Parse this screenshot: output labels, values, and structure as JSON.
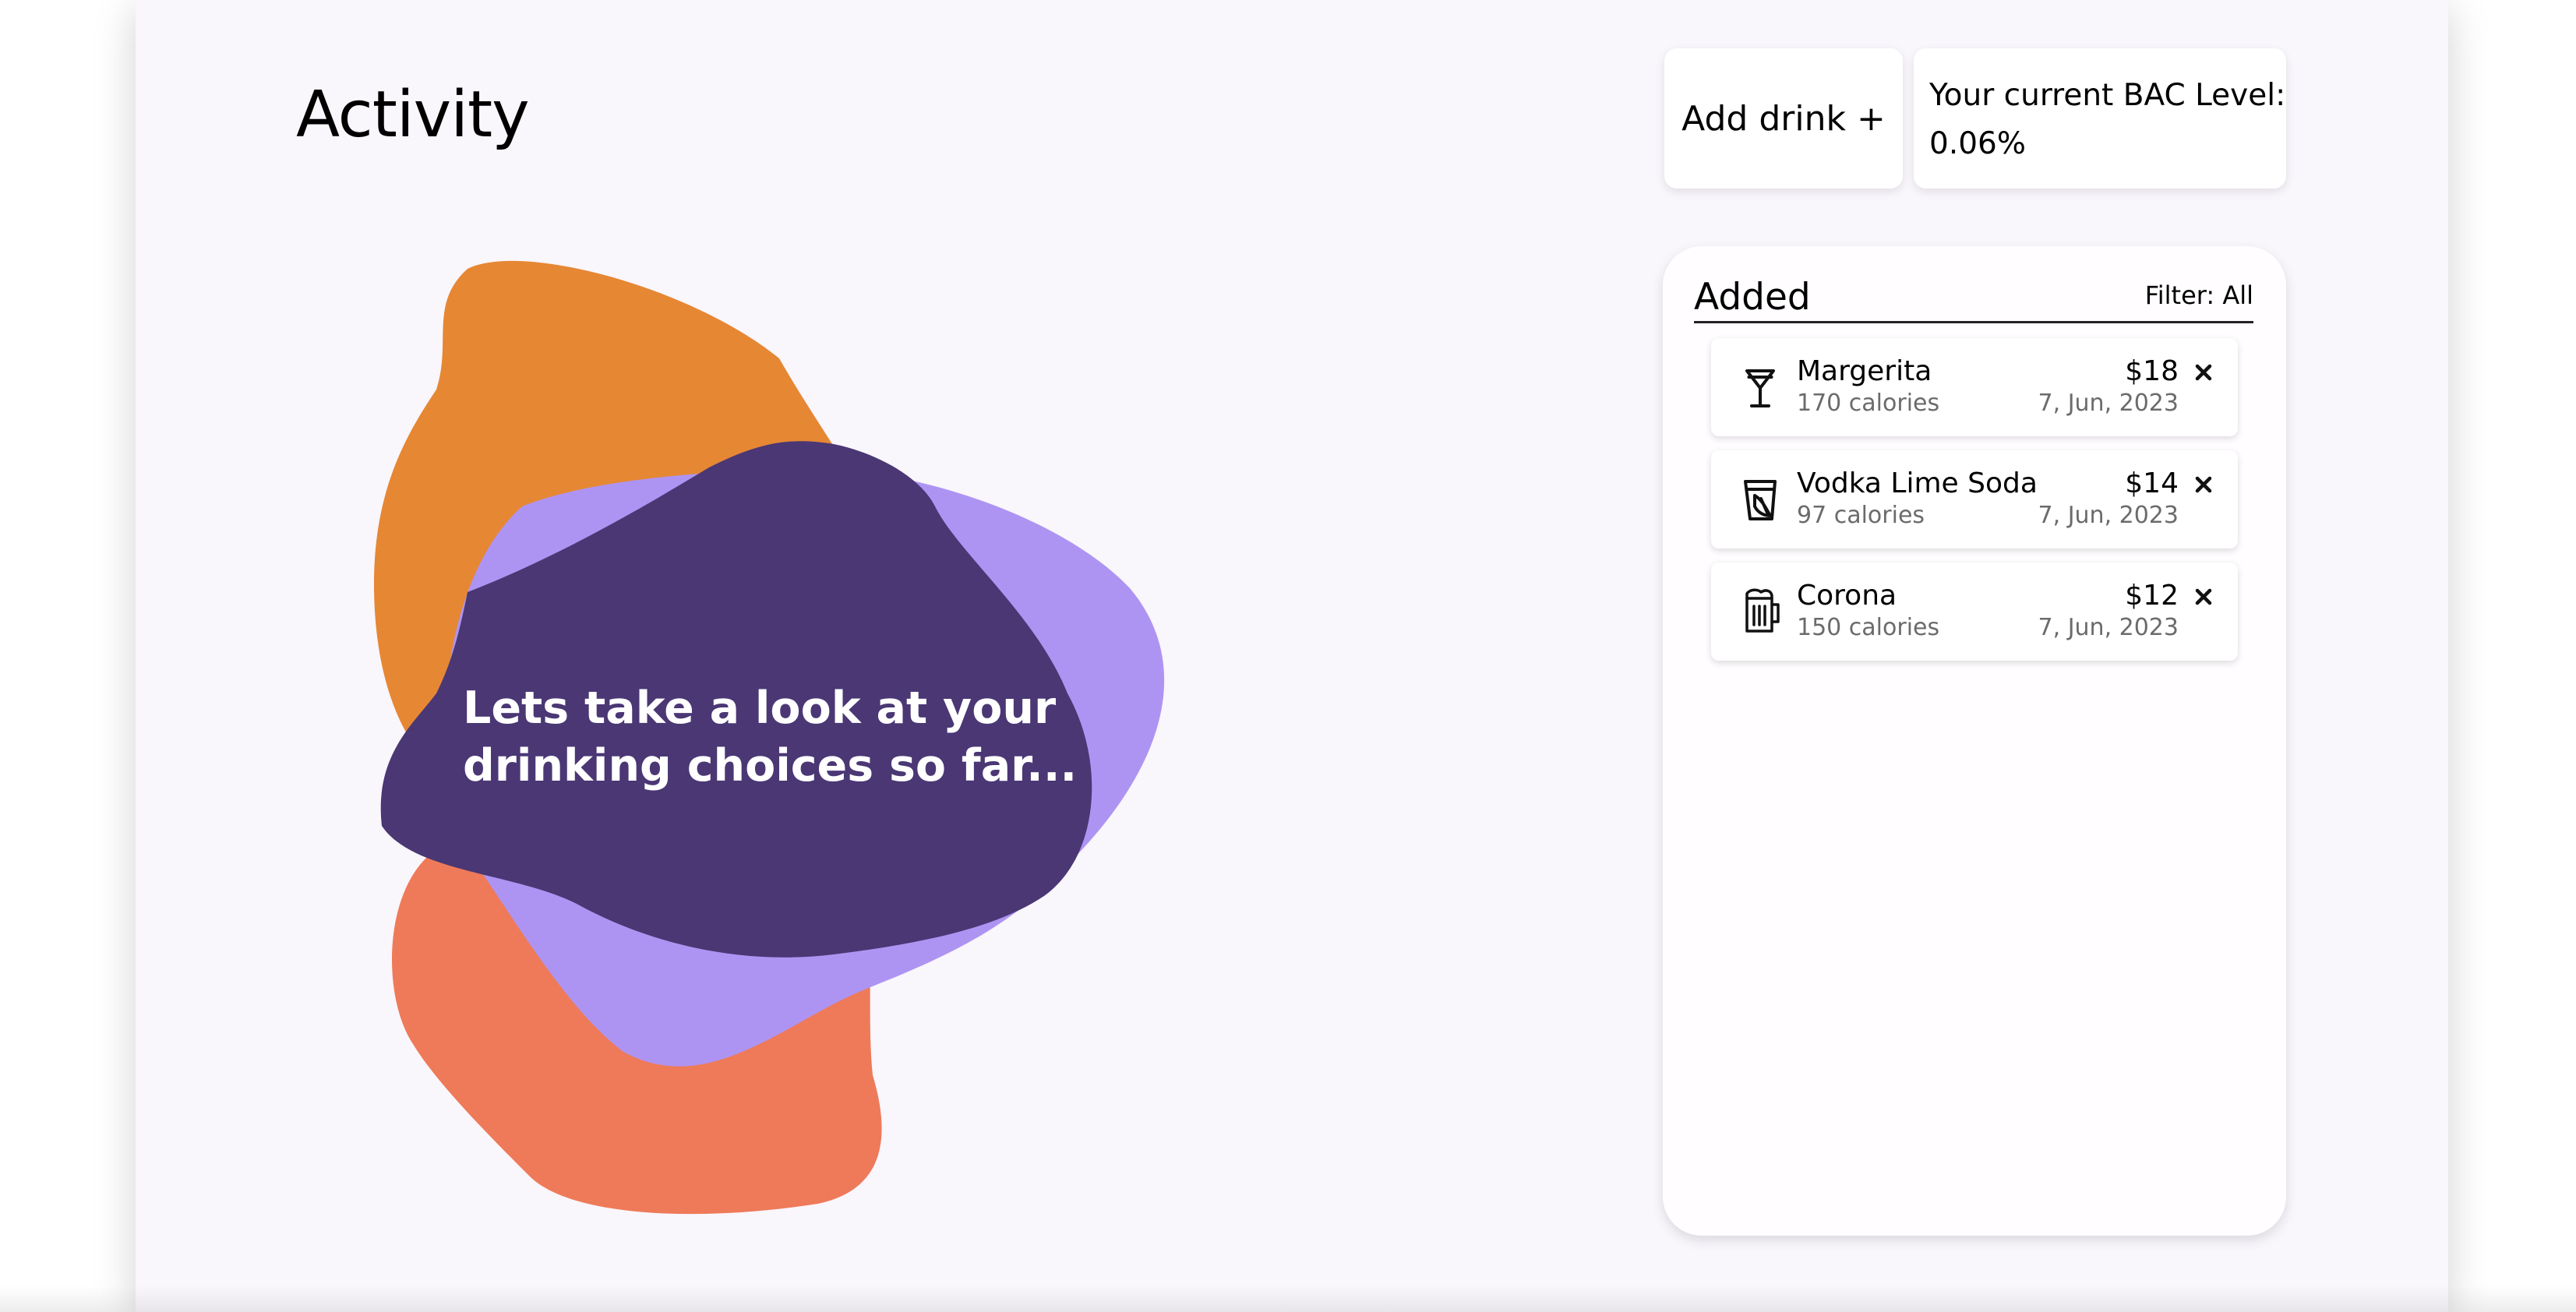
{
  "page": {
    "title": "Activity",
    "hero_text": "Lets take a look at your drinking choices so far..."
  },
  "header": {
    "add_drink_label": "Add drink +",
    "bac_label": "Your current BAC Level:",
    "bac_value": "0.06%"
  },
  "added_panel": {
    "title": "Added",
    "filter_label": "Filter: All",
    "items": [
      {
        "name": "Margerita",
        "calories": "170 calories",
        "price": "$18",
        "date": "7, Jun, 2023",
        "icon": "cocktail-glass-icon"
      },
      {
        "name": "Vodka Lime Soda",
        "calories": "97 calories",
        "price": "$14",
        "date": "7, Jun, 2023",
        "icon": "soda-glass-icon"
      },
      {
        "name": "Corona",
        "calories": "150 calories",
        "price": "$12",
        "date": "7, Jun, 2023",
        "icon": "beer-mug-icon"
      }
    ]
  },
  "colors": {
    "page_background": "#f9f6fc",
    "blob_orange": "#e68734",
    "blob_coral": "#ee7a59",
    "blob_lavender": "#ae94f2",
    "blob_purple": "#4a3774"
  }
}
